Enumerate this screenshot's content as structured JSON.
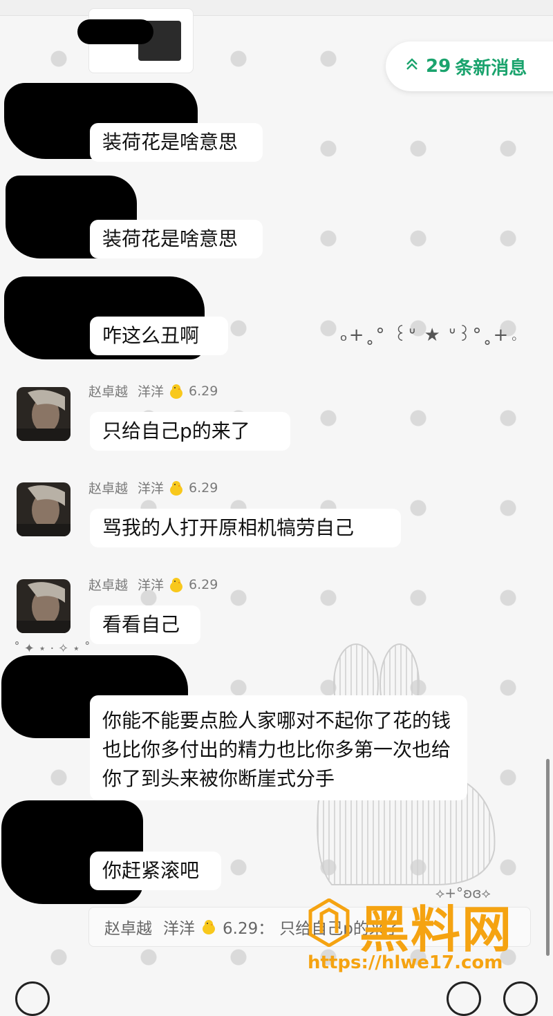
{
  "new_messages": {
    "count": "29",
    "label": "条新消息"
  },
  "messages": [
    {
      "text": "装荷花是啥意思"
    },
    {
      "text": "装荷花是啥意思"
    },
    {
      "text": "咋这么丑啊"
    },
    {
      "sender": "赵卓越",
      "nickname": "洋洋",
      "suffix": "6.29",
      "text": "只给自己p的来了"
    },
    {
      "sender": "赵卓越",
      "nickname": "洋洋",
      "suffix": "6.29",
      "text": "骂我的人打开原相机犒劳自己"
    },
    {
      "sender": "赵卓越",
      "nickname": "洋洋",
      "suffix": "6.29",
      "text": "看看自己"
    },
    {
      "text": "你能不能要点脸人家哪对不起你了花的钱也比你多付出的精力也比你多第一次也给你了到头来被你断崖式分手"
    },
    {
      "text": "你赶紧滚吧"
    }
  ],
  "decor": {
    "kaomoji": "ₒ+˳° ꒰ᐡ ★ ᐡ꒱°˳+。",
    "sparkles": "⟡+°ʚɞ⟡",
    "stars": "˚ ✦ ⋆ · ✧ ⋆ ˚"
  },
  "quote": {
    "sender": "赵卓越",
    "nickname": "洋洋",
    "suffix": "6.29：",
    "text": "只给自己p的来了"
  },
  "watermark": {
    "title": "黑料网",
    "url": "https://hlwe17.com"
  },
  "colors": {
    "accent": "#1aa36d",
    "watermark": "#f5a311"
  },
  "icons": [
    "voice-icon",
    "emoji-icon",
    "add-icon",
    "chevron-up-icon",
    "chick-emoji-icon"
  ]
}
